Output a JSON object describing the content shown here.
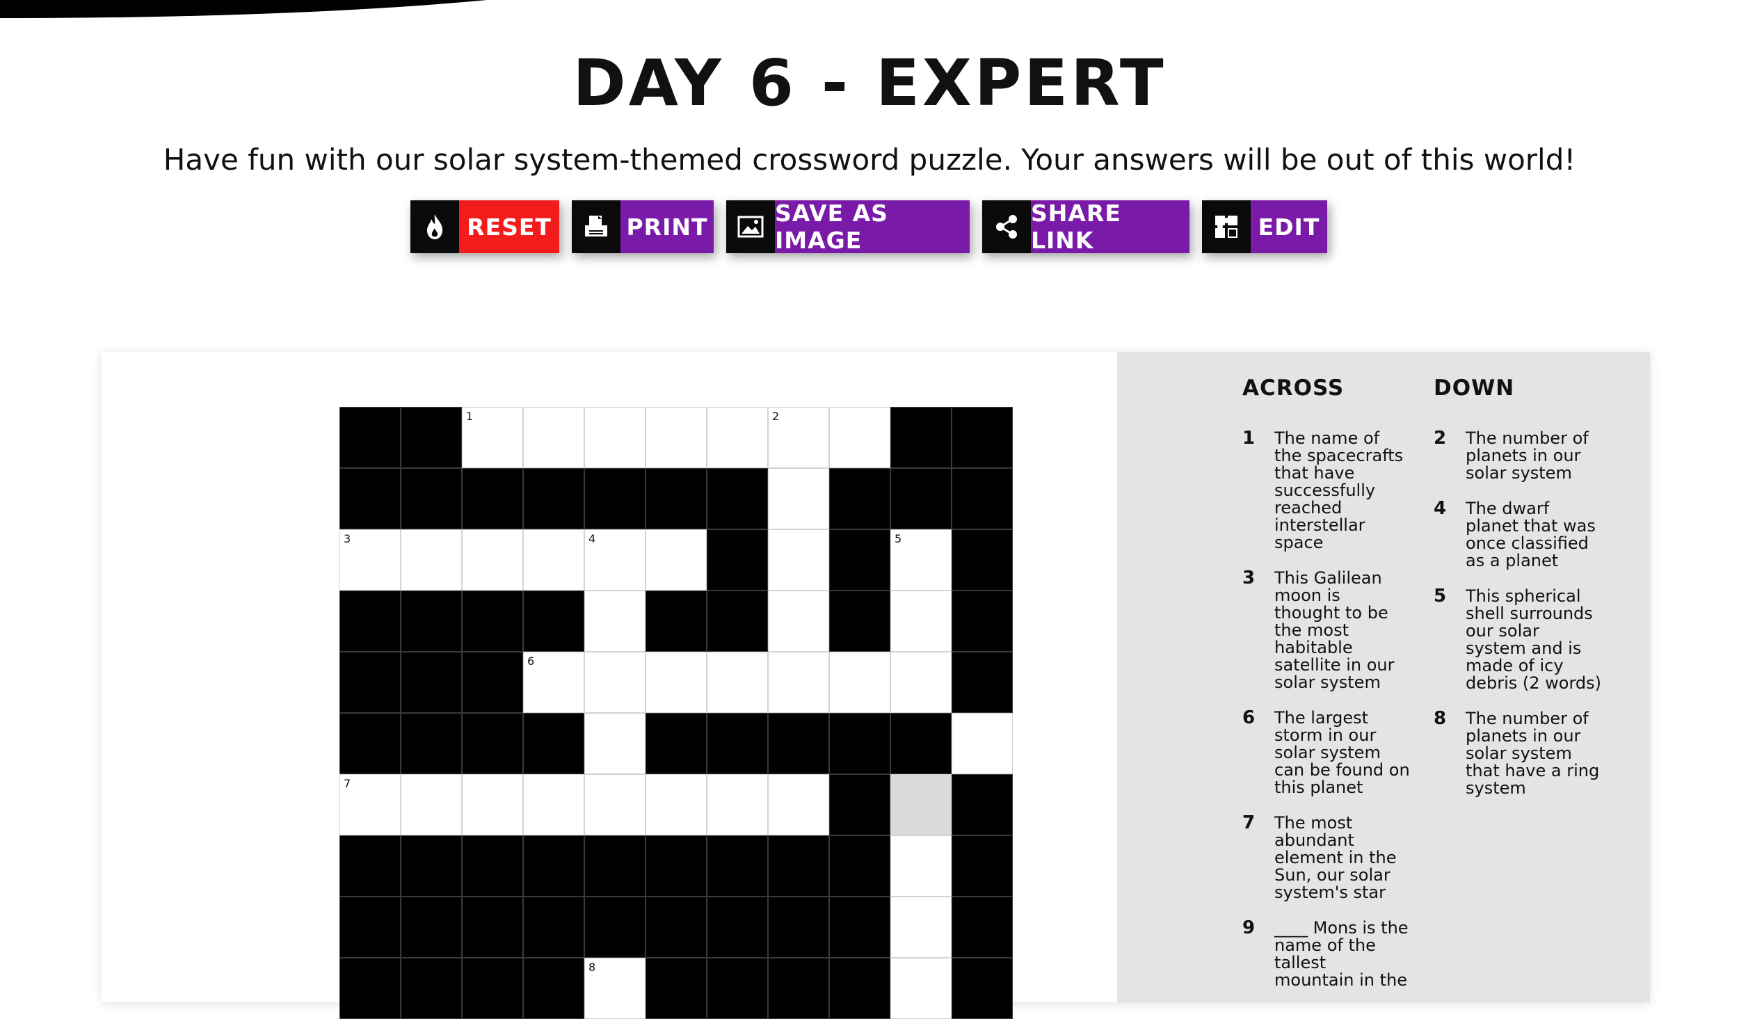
{
  "title": "DAY 6 - EXPERT",
  "subtitle": "Have fun with our solar system-themed crossword puzzle. Your answers will be out of this world!",
  "toolbar": {
    "buttons": [
      {
        "label": "RESET",
        "icon": "flame-icon",
        "color": "#f21c1c"
      },
      {
        "label": "PRINT",
        "icon": "printer-icon",
        "color": "#7a1aa8"
      },
      {
        "label": "SAVE AS IMAGE",
        "icon": "image-icon",
        "color": "#7a1aa8"
      },
      {
        "label": "SHARE LINK",
        "icon": "share-icon",
        "color": "#7a1aa8"
      },
      {
        "label": "EDIT",
        "icon": "puzzle-icon",
        "color": "#7a1aa8"
      }
    ]
  },
  "crossword": {
    "columns": 11,
    "rows": [
      "##.....0.##",
      "#######.###",
      "......#.#.#",
      "####.##.#.#",
      "###.......#",
      "####.#####.#",
      "........#a#",
      "#########.#",
      "#########.#",
      "####.####.#"
    ],
    "numbers": [
      {
        "r": 0,
        "c": 2,
        "n": "1"
      },
      {
        "r": 0,
        "c": 7,
        "n": "2"
      },
      {
        "r": 2,
        "c": 0,
        "n": "3"
      },
      {
        "r": 2,
        "c": 4,
        "n": "4"
      },
      {
        "r": 2,
        "c": 9,
        "n": "5"
      },
      {
        "r": 4,
        "c": 3,
        "n": "6"
      },
      {
        "r": 6,
        "c": 0,
        "n": "7"
      },
      {
        "r": 9,
        "c": 4,
        "n": "8"
      }
    ]
  },
  "clues": {
    "across_title": "ACROSS",
    "down_title": "DOWN",
    "across": [
      {
        "num": "1",
        "text": "The name of the spacecrafts that have successfully reached interstellar space"
      },
      {
        "num": "3",
        "text": "This Galilean moon is thought to be the most habitable satellite in our solar system"
      },
      {
        "num": "6",
        "text": "The largest storm in our solar system can be found on this planet"
      },
      {
        "num": "7",
        "text": "The most abundant element in the Sun, our solar system's star"
      },
      {
        "num": "9",
        "text": "____ Mons is the name of the tallest mountain in the"
      }
    ],
    "down": [
      {
        "num": "2",
        "text": "The number of planets in our solar system"
      },
      {
        "num": "4",
        "text": "The dwarf planet that was once classified as a planet"
      },
      {
        "num": "5",
        "text": "This spherical shell surrounds our solar system and is made of icy debris (2 words)"
      },
      {
        "num": "8",
        "text": "The number of planets in our solar system that have a ring system"
      }
    ]
  }
}
